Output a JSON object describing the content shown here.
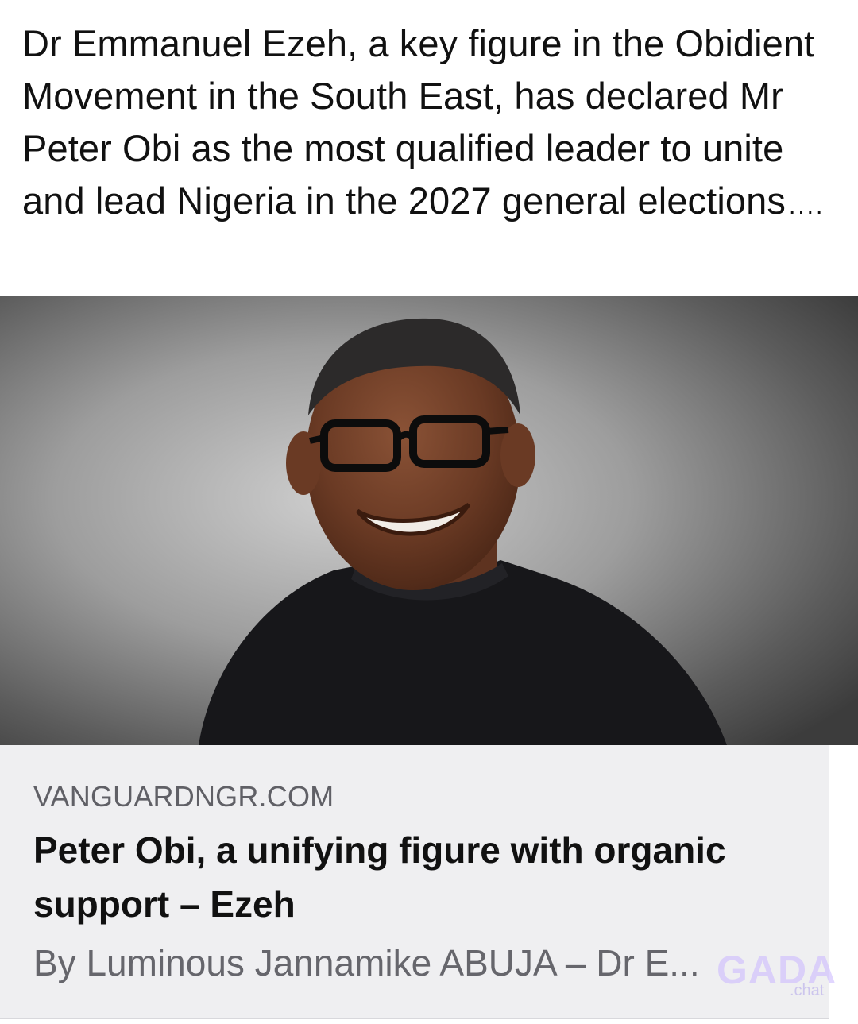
{
  "post": {
    "text": "Dr Emmanuel Ezeh, a key figure in the Obidient Movement in the South East, has declared Mr Peter Obi as the most qualified leader to unite and lead Nigeria in the 2027 general elections",
    "ellipsis": "...."
  },
  "link_preview": {
    "domain": "VANGUARDNGR.COM",
    "headline": "Peter Obi, a unifying figure with organic support – Ezeh",
    "snippet": "By Luminous Jannamike ABUJA – Dr E..."
  },
  "watermark": {
    "brand": "GADA",
    "sub": ".chat"
  },
  "colors": {
    "background": "#ffffff",
    "card_background": "#efeff1",
    "domain_text": "#606066",
    "headline_text": "#111111",
    "snippet_text": "#66666c"
  }
}
